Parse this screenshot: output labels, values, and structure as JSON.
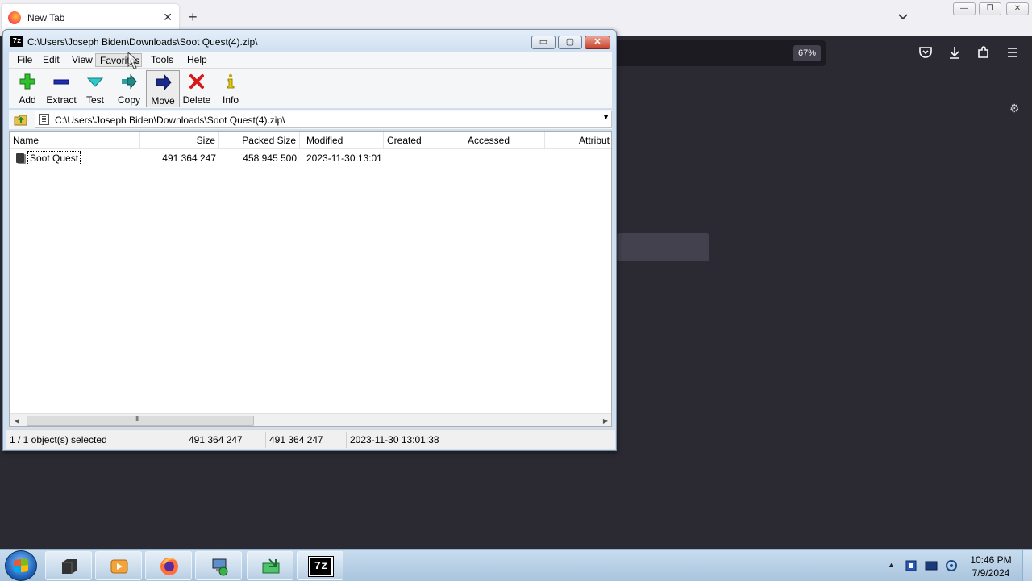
{
  "browser": {
    "tab_title": "New Tab",
    "tab_close": "✕",
    "new_tab": "+",
    "zoom_level": "67%",
    "window_controls": [
      "—",
      "❐",
      "✕"
    ]
  },
  "sevenzip": {
    "title": "C:\\Users\\Joseph Biden\\Downloads\\Soot Quest(4).zip\\",
    "title_icon_text": "7z",
    "title_buttons": {
      "minimize": "▭",
      "maximize": "▢",
      "close": "✕"
    },
    "menu": [
      "File",
      "Edit",
      "View",
      "Favorites",
      "Tools",
      "Help"
    ],
    "toolbar": [
      {
        "label": "Add",
        "icon": "add-icon"
      },
      {
        "label": "Extract",
        "icon": "extract-icon"
      },
      {
        "label": "Test",
        "icon": "test-icon"
      },
      {
        "label": "Copy",
        "icon": "copy-icon"
      },
      {
        "label": "Move",
        "icon": "move-icon"
      },
      {
        "label": "Delete",
        "icon": "delete-icon"
      },
      {
        "label": "Info",
        "icon": "info-icon"
      }
    ],
    "address": "C:\\Users\\Joseph Biden\\Downloads\\Soot Quest(4).zip\\",
    "columns": [
      "Name",
      "Size",
      "Packed Size",
      "Modified",
      "Created",
      "Accessed",
      "Attribut"
    ],
    "rows": [
      {
        "name": "Soot Quest",
        "size": "491 364 247",
        "packed_size": "458 945 500",
        "modified": "2023-11-30 13:01",
        "created": "",
        "accessed": "",
        "attributes": ""
      }
    ],
    "status": {
      "selection": "1 / 1 object(s) selected",
      "size": "491 364 247",
      "packed": "491 364 247",
      "modified": "2023-11-30 13:01:38"
    },
    "scrollbar_grip": "III"
  },
  "taskbar": {
    "apps": [
      "terminal",
      "media-player",
      "firefox",
      "network-computer",
      "file-manager",
      "7-zip"
    ],
    "app_7zip_label": "7z",
    "tray_expand": "▲",
    "clock_time": "10:46 PM",
    "clock_date": "7/9/2024"
  },
  "colors": {
    "firefox_dark": "#2b2a33",
    "window_frame": "#cfdff0",
    "taskbar": "#b9d1ea"
  }
}
